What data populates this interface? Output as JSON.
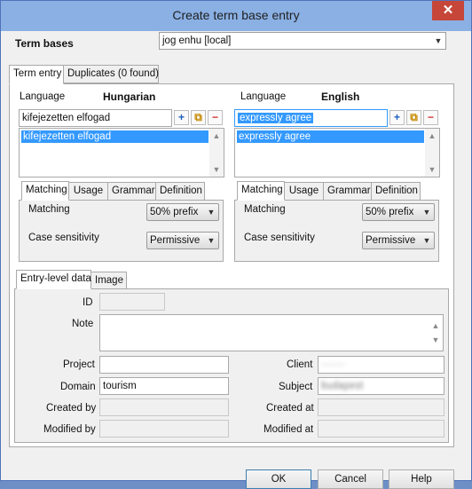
{
  "window": {
    "title": "Create term base entry",
    "close_glyph": "✕"
  },
  "term_bases": {
    "label": "Term bases",
    "value": "jog enhu [local]"
  },
  "outer_tabs": [
    "Term entry",
    "Duplicates (0 found)"
  ],
  "left_lang": {
    "label": "Language",
    "name": "Hungarian",
    "term_value": "kifejezetten elfogad",
    "list_items": [
      "kifejezetten elfogad"
    ],
    "sub_tabs": [
      "Matching",
      "Usage",
      "Grammar",
      "Definition"
    ],
    "matching_label": "Matching",
    "matching_value": "50% prefix",
    "case_label": "Case sensitivity",
    "case_value": "Permissive"
  },
  "right_lang": {
    "label": "Language",
    "name": "English",
    "term_value": "expressly agree",
    "list_items": [
      "expressly agree"
    ],
    "sub_tabs": [
      "Matching",
      "Usage",
      "Grammar",
      "Definition"
    ],
    "matching_label": "Matching",
    "matching_value": "50% prefix",
    "case_label": "Case sensitivity",
    "case_value": "Permissive"
  },
  "icons": {
    "add": "+",
    "copy": "⧉",
    "remove": "−",
    "chevron": "▼",
    "up": "▲",
    "down": "▼"
  },
  "entry_tabs": [
    "Entry-level data",
    "Image"
  ],
  "entry": {
    "id_label": "ID",
    "id_value": "",
    "note_label": "Note",
    "note_value": "",
    "project_label": "Project",
    "project_value": "",
    "client_label": "Client",
    "client_value": "·······",
    "domain_label": "Domain",
    "domain_value": "tourism",
    "subject_label": "Subject",
    "subject_value": "budapest",
    "created_by_label": "Created by",
    "created_by_value": "",
    "created_at_label": "Created at",
    "created_at_value": "",
    "modified_by_label": "Modified by",
    "modified_by_value": "",
    "modified_at_label": "Modified at",
    "modified_at_value": ""
  },
  "buttons": {
    "ok": "OK",
    "cancel": "Cancel",
    "help": "Help"
  },
  "colors": {
    "title_bar": "#8ab0e4",
    "selection": "#3399ff",
    "close": "#c7463a"
  }
}
